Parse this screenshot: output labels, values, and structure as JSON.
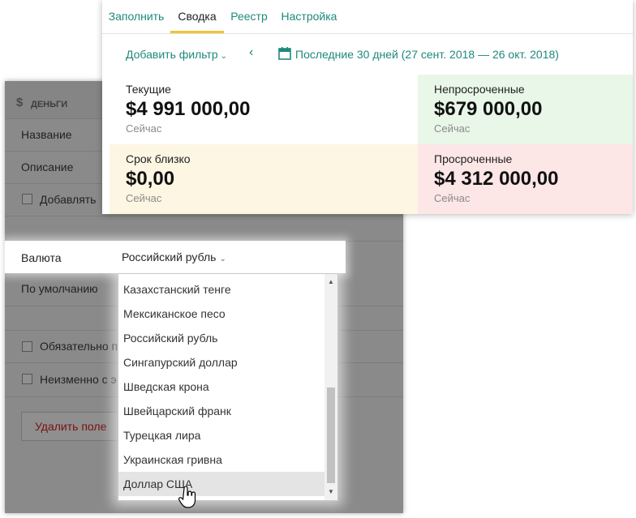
{
  "tabs": [
    {
      "label": "Заполнить",
      "active": false
    },
    {
      "label": "Сводка",
      "active": true
    },
    {
      "label": "Реестр",
      "active": false
    },
    {
      "label": "Настройка",
      "active": false
    }
  ],
  "filter": {
    "add_label": "Добавить фильтр",
    "prev_label": "‹",
    "period": "Последние 30 дней (27 сент. 2018 — 26 окт. 2018)"
  },
  "stats": {
    "current": {
      "label": "Текущие",
      "value": "$4 991 000,00",
      "sub": "Сейчас"
    },
    "not_overdue": {
      "label": "Непросроченные",
      "value": "$679 000,00",
      "sub": "Сейчас"
    },
    "due_soon": {
      "label": "Срок близко",
      "value": "$0,00",
      "sub": "Сейчас"
    },
    "overdue": {
      "label": "Просроченные",
      "value": "$4 312 000,00",
      "sub": "Сейчас"
    }
  },
  "settings": {
    "title": "ДЕНЬГИ",
    "money_icon": "$",
    "name_label": "Название",
    "description_label": "Описание",
    "add_label": "Добавлять",
    "currency_label": "Валюта",
    "currency_value": "Российский рубль",
    "default_label": "По умолчанию",
    "required_label": "Обязательно п",
    "invariant_label": "Неизменно с э",
    "delete_label": "Удалить поле"
  },
  "currency_options": [
    "Казахстанский тенге",
    "Мексиканское песо",
    "Российский рубль",
    "Сингапурский доллар",
    "Шведская крона",
    "Швейцарский франк",
    "Турецкая лира",
    "Украинская гривна",
    "Доллар США"
  ],
  "hovered_option": "Доллар США",
  "colors": {
    "accent": "#1d8a7a",
    "tab_underline": "#f2c231",
    "not_overdue_bg": "#e8f7e8",
    "due_soon_bg": "#fdf6e3",
    "overdue_bg": "#fde6e6"
  },
  "icons": {
    "calendar": "calendar-icon",
    "money": "dollar-icon",
    "cursor": "hand-cursor-icon"
  }
}
